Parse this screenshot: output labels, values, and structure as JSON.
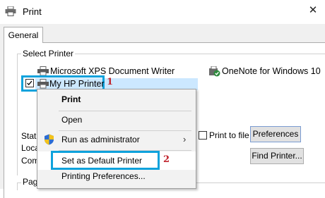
{
  "window": {
    "title": "Print"
  },
  "tabs": [
    {
      "label": "General"
    }
  ],
  "select_printer": {
    "label": "Select Printer",
    "printers": [
      {
        "name": "Microsoft XPS Document Writer"
      },
      {
        "name": "OneNote for Windows 10"
      },
      {
        "name": "My HP Printer"
      }
    ]
  },
  "status_labels": {
    "status": "Stat",
    "location": "Loca",
    "comment": "Com"
  },
  "print_to_file": {
    "label": "Print to file"
  },
  "buttons": {
    "preferences": "Preferences",
    "find_printer": "Find Printer..."
  },
  "page_range": {
    "label": "Pag"
  },
  "context_menu": {
    "items": [
      {
        "label": "Print"
      },
      {
        "label": "Open"
      },
      {
        "label": "Run as administrator"
      },
      {
        "label": "Set as Default Printer"
      },
      {
        "label": "Printing Preferences..."
      }
    ]
  },
  "annotations": {
    "step1": "1",
    "step2": "2"
  },
  "colors": {
    "highlight_border": "#0ea2dc",
    "annotation_number": "#c0232c",
    "selection": "#cce8ff"
  }
}
